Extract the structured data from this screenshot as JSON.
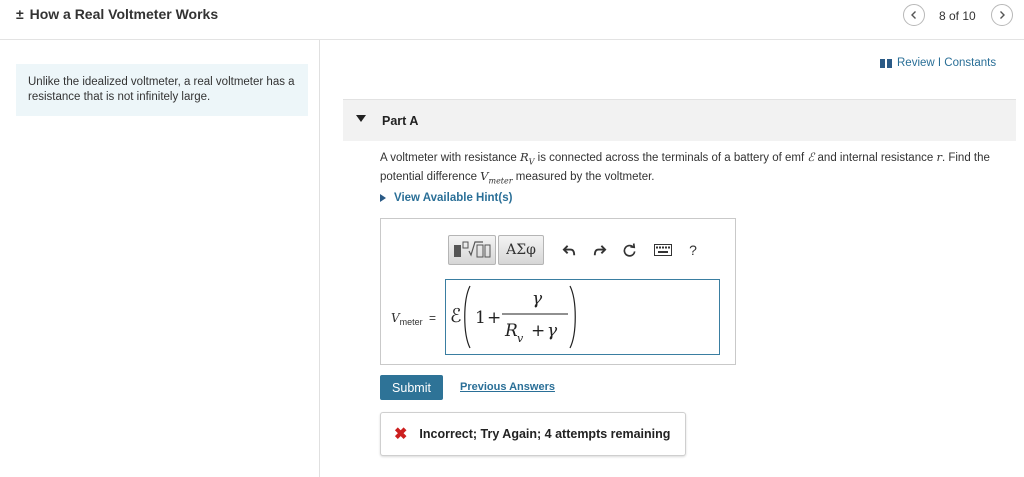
{
  "header": {
    "title_prefix": "±",
    "title": "How a Real Voltmeter Works",
    "counter": "8 of 10"
  },
  "intro": {
    "text": "Unlike the idealized voltmeter, a real voltmeter has a resistance that is not infinitely large."
  },
  "links": {
    "review_constants": "Review I Constants",
    "view_hints": "View Available Hint(s)",
    "previous_answers": "Previous Answers"
  },
  "part": {
    "label": "Part A"
  },
  "question": {
    "t1": "A voltmeter with resistance ",
    "rv_main": "R",
    "rv_sub": "V",
    "t2": " is connected across the terminals of a battery of emf ",
    "emf": "ℰ",
    "t3": " and internal resistance ",
    "r": "r",
    "t4": ". Find the potential difference ",
    "v_main": "V",
    "v_sub": "meter",
    "t5": " measured by the voltmeter."
  },
  "toolbar": {
    "greek": "ΑΣφ",
    "help": "?"
  },
  "answer": {
    "var_main": "V",
    "var_sub": "meter",
    "equals": "=",
    "emf": "ℰ",
    "one": "1",
    "plus1": "+",
    "numerator": "γ",
    "den_R": "R",
    "den_sub": "v",
    "plus2": "+",
    "den_gamma": "γ"
  },
  "actions": {
    "submit": "Submit"
  },
  "feedback": {
    "icon": "✖",
    "text": "Incorrect; Try Again; 4 attempts remaining"
  },
  "colors": {
    "accent": "#2e7397",
    "link": "#2a6f97",
    "error": "#cc1f1f",
    "intro_bg": "#edf6f9"
  }
}
